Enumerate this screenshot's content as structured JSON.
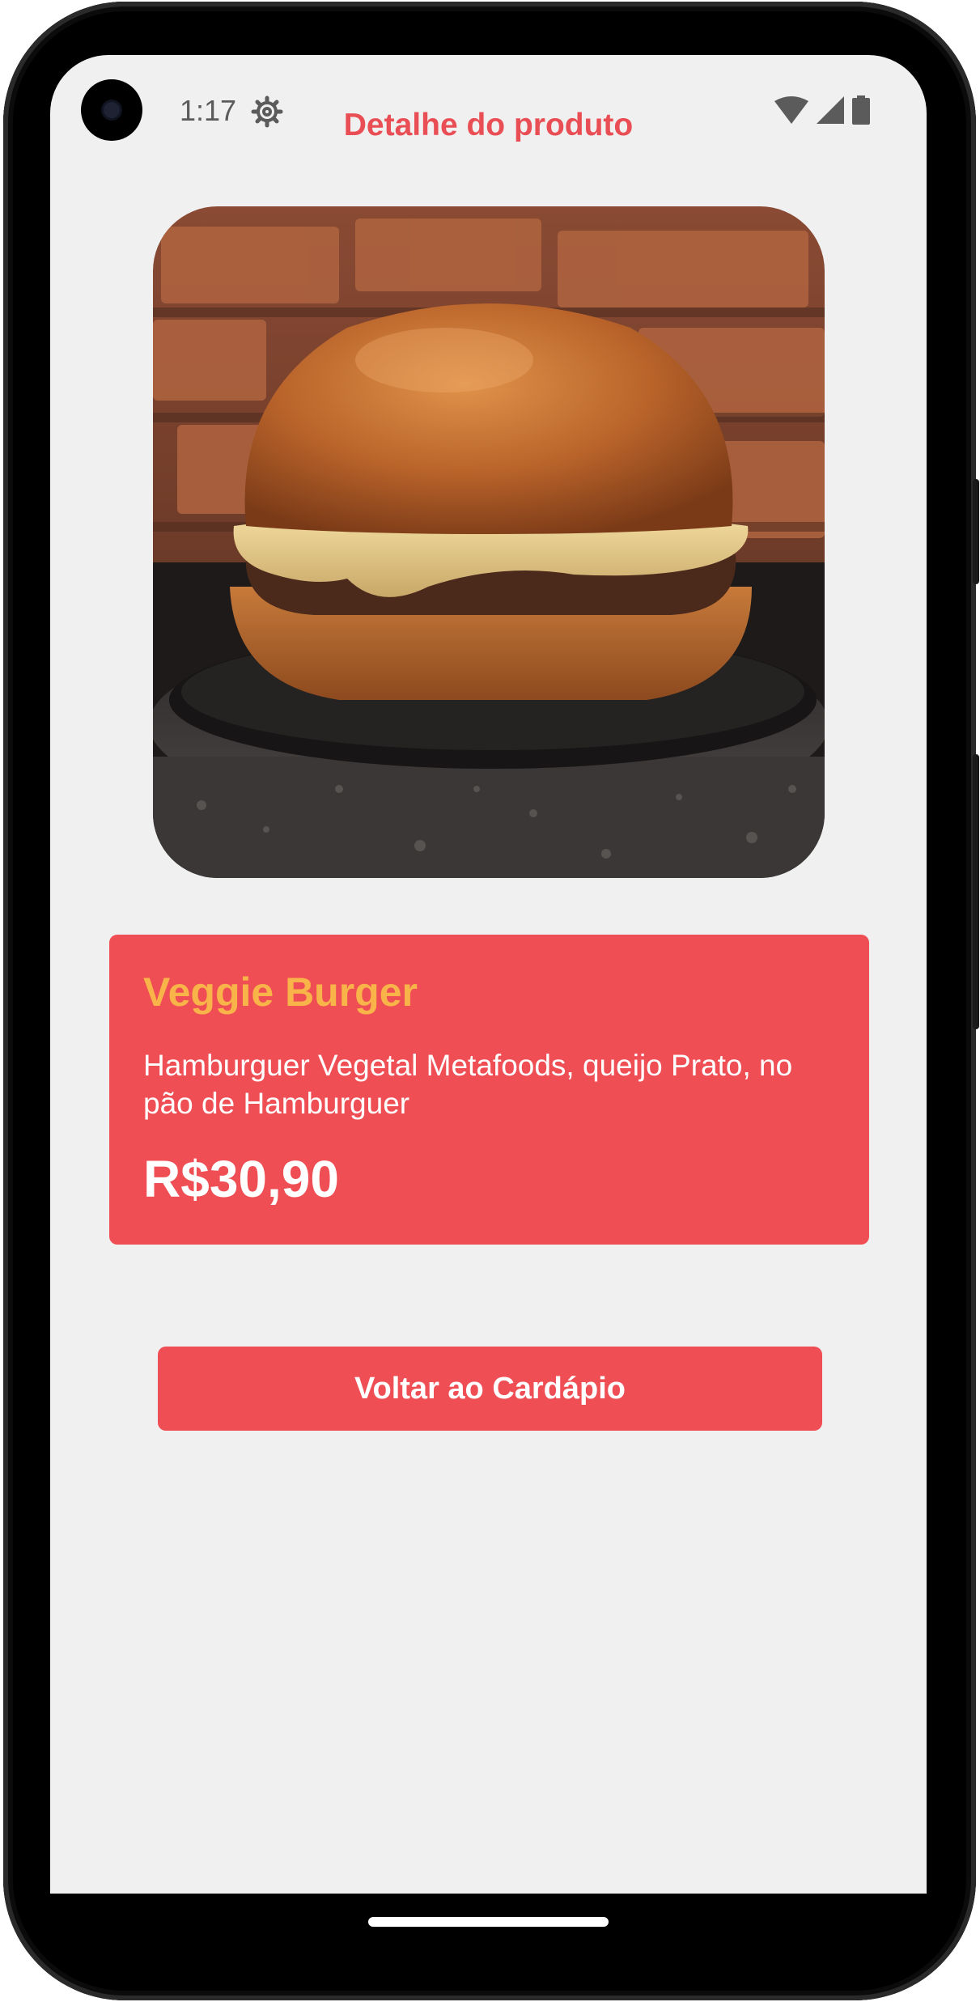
{
  "status_bar": {
    "time": "1:17",
    "icons": [
      "settings-gear-icon",
      "wifi-icon",
      "cellular-signal-icon",
      "battery-icon"
    ]
  },
  "header": {
    "title": "Detalhe do produto"
  },
  "product": {
    "image_subject": "burger-photo",
    "name": "Veggie Burger",
    "description": "Hamburguer Vegetal Metafoods, queijo Prato, no pão de Hamburguer",
    "price": "R$30,90"
  },
  "actions": {
    "back_label": "Voltar ao Cardápio"
  },
  "colors": {
    "accent": "#ef4e54",
    "title_red": "#e94e55",
    "product_name": "#f8b449",
    "background": "#f1f0f1"
  }
}
